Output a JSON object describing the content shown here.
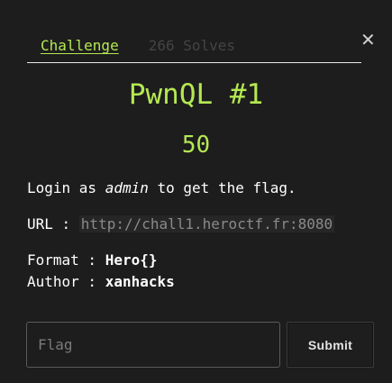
{
  "tabs": {
    "challenge_label": "Challenge",
    "solves_label": "266 Solves"
  },
  "close_glyph": "✕",
  "challenge": {
    "name": "PwnQL #1",
    "points": "50",
    "desc_prefix": "Login as ",
    "desc_emph": "admin",
    "desc_suffix": " to get the flag.",
    "url_label": "URL : ",
    "url": "http://chall1.heroctf.fr:8080",
    "format_label": "Format : ",
    "format_value": "Hero{}",
    "author_label": "Author : ",
    "author_value": "xanhacks"
  },
  "form": {
    "flag_placeholder": "Flag",
    "flag_value": "",
    "submit_label": "Submit"
  },
  "colors": {
    "accent": "#b5e853",
    "background": "#1d1d1d"
  }
}
